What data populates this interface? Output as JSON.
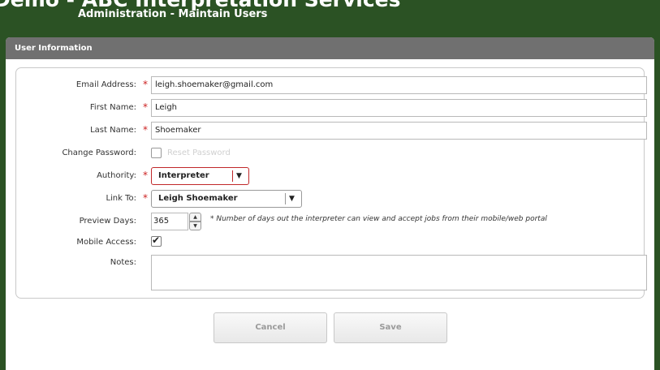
{
  "header": {
    "title": "Demo - ABC Interpretation Services",
    "subtitle": "Administration - Maintain Users"
  },
  "panel": {
    "title": "User Information"
  },
  "form": {
    "email": {
      "label": "Email Address:",
      "required": "*",
      "value": "leigh.shoemaker@gmail.com"
    },
    "first_name": {
      "label": "First Name:",
      "required": "*",
      "value": "Leigh"
    },
    "last_name": {
      "label": "Last Name:",
      "required": "*",
      "value": "Shoemaker"
    },
    "change_password": {
      "label": "Change Password:",
      "checkbox_label": "Reset Password",
      "checked": false
    },
    "authority": {
      "label": "Authority:",
      "required": "*",
      "value": "Interpreter",
      "arrow": "▼"
    },
    "link_to": {
      "label": "Link To:",
      "required": "*",
      "value": "Leigh Shoemaker",
      "arrow": "▼"
    },
    "preview_days": {
      "label": "Preview Days:",
      "value": "365",
      "up": "▲",
      "down": "▼",
      "note": "* Number of days out the interpreter can view and accept jobs from their mobile/web portal"
    },
    "mobile_access": {
      "label": "Mobile Access:",
      "checked": true,
      "check_glyph": "✔"
    },
    "notes": {
      "label": "Notes:",
      "value": ""
    }
  },
  "buttons": {
    "cancel": "Cancel",
    "save": "Save"
  },
  "colors": {
    "background": "#2b5224",
    "panel_header": "#707070",
    "required": "#cc2222",
    "authority_border": "#c0282a"
  }
}
